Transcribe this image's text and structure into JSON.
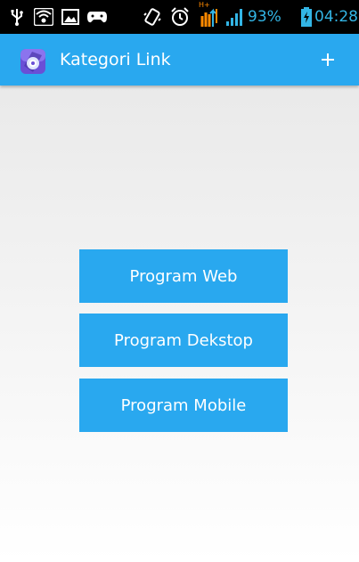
{
  "status_bar": {
    "icons": [
      "usb-icon",
      "wifi-icon",
      "image-icon",
      "gamepad-icon",
      "vibrate-icon",
      "alarm-icon",
      "network-hplus-icon",
      "signal-icon",
      "battery-icon"
    ],
    "network_label": "H+",
    "battery_percent": "93%",
    "time": "04:28"
  },
  "action_bar": {
    "title": "Kategori Link",
    "add_label": "+"
  },
  "categories": [
    {
      "label": "Program Web"
    },
    {
      "label": "Program Dekstop"
    },
    {
      "label": "Program Mobile"
    }
  ],
  "colors": {
    "accent": "#29a8ef",
    "status_text": "#33b5e5"
  }
}
